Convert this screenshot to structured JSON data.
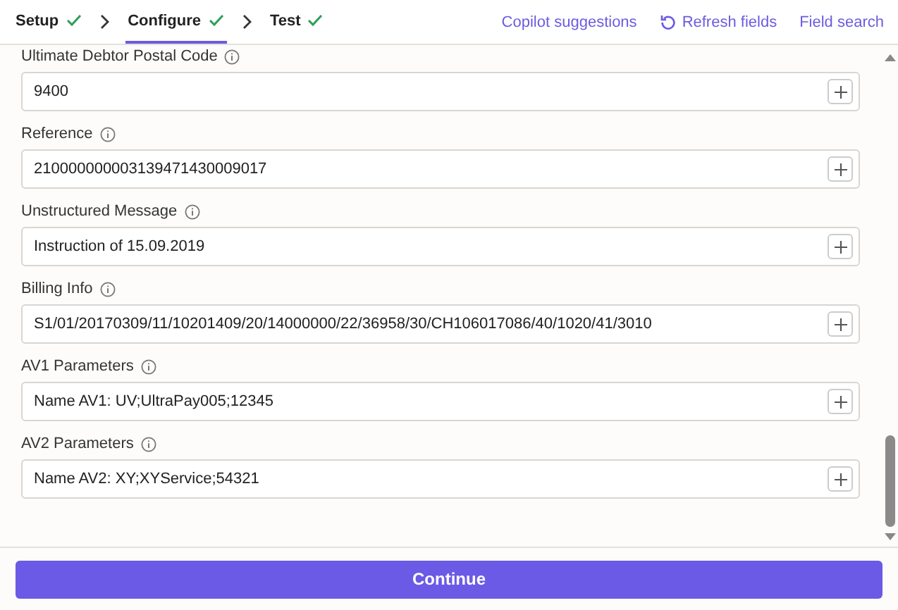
{
  "steps": [
    {
      "label": "Setup",
      "completed": true,
      "selected": false
    },
    {
      "label": "Configure",
      "completed": true,
      "selected": true
    },
    {
      "label": "Test",
      "completed": true,
      "selected": false
    }
  ],
  "actions": [
    {
      "label": "Copilot suggestions",
      "kind": "plain"
    },
    {
      "label": "Refresh fields",
      "kind": "refresh"
    },
    {
      "label": "Field search",
      "kind": "plain"
    }
  ],
  "fields": [
    {
      "label": "Ultimate Debtor Postal Code",
      "value": "9400"
    },
    {
      "label": "Reference",
      "value": "210000000003139471430009017"
    },
    {
      "label": "Unstructured Message",
      "value": "Instruction of 15.09.2019"
    },
    {
      "label": "Billing Info",
      "value": "S1/01/20170309/11/10201409/20/14000000/22/36958/30/CH106017086/40/1020/41/3010"
    },
    {
      "label": "AV1 Parameters",
      "value": "Name AV1: UV;UltraPay005;12345"
    },
    {
      "label": "AV2 Parameters",
      "value": "Name AV2: XY;XYService;54321"
    }
  ],
  "continue_button": {
    "label": "Continue"
  }
}
